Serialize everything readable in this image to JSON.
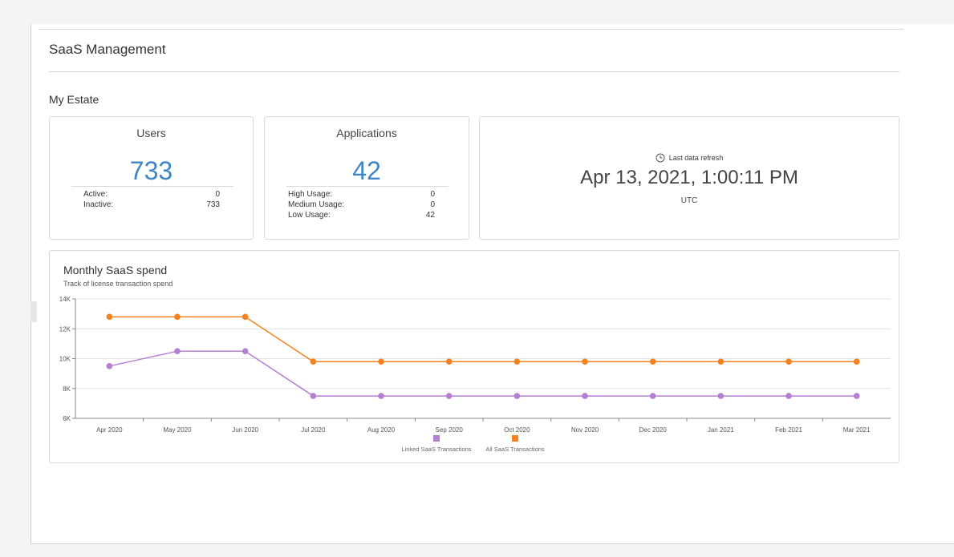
{
  "page": {
    "title": "SaaS Management"
  },
  "section": {
    "title": "My Estate"
  },
  "users": {
    "title": "Users",
    "total": "733",
    "rows": [
      {
        "label": "Active:",
        "value": "0"
      },
      {
        "label": "Inactive:",
        "value": "733"
      }
    ]
  },
  "applications": {
    "title": "Applications",
    "total": "42",
    "rows": [
      {
        "label": "High Usage:",
        "value": "0"
      },
      {
        "label": "Medium Usage:",
        "value": "0"
      },
      {
        "label": "Low Usage:",
        "value": "42"
      }
    ]
  },
  "refresh": {
    "icon": "clock-icon",
    "label": "Last data refresh",
    "time": "Apr 13, 2021, 1:00:11 PM",
    "timezone": "UTC"
  },
  "chart": {
    "title": "Monthly SaaS spend",
    "subtitle": "Track of license transaction spend"
  },
  "chart_data": {
    "type": "line",
    "title": "Monthly SaaS spend",
    "subtitle": "Track of license transaction spend",
    "x": [
      "Apr 2020",
      "May 2020",
      "Jun 2020",
      "Jul 2020",
      "Aug 2020",
      "Sep 2020",
      "Oct 2020",
      "Nov 2020",
      "Dec 2020",
      "Jan 2021",
      "Feb 2021",
      "Mar 2021"
    ],
    "series": [
      {
        "name": "Linked SaaS Transactions",
        "color": "#b57fd1",
        "values": [
          9500,
          10500,
          10500,
          7500,
          7500,
          7500,
          7500,
          7500,
          7500,
          7500,
          7500,
          7500
        ]
      },
      {
        "name": "All SaaS Transactions",
        "color": "#f7811f",
        "values": [
          12800,
          12800,
          12800,
          9800,
          9800,
          9800,
          9800,
          9800,
          9800,
          9800,
          9800,
          9800
        ]
      }
    ],
    "ylim": [
      6000,
      14000
    ],
    "yticks": [
      6000,
      8000,
      10000,
      12000,
      14000
    ],
    "ytick_labels": [
      "6K",
      "8K",
      "10K",
      "12K",
      "14K"
    ],
    "grid": true,
    "legend": "bottom-center"
  }
}
